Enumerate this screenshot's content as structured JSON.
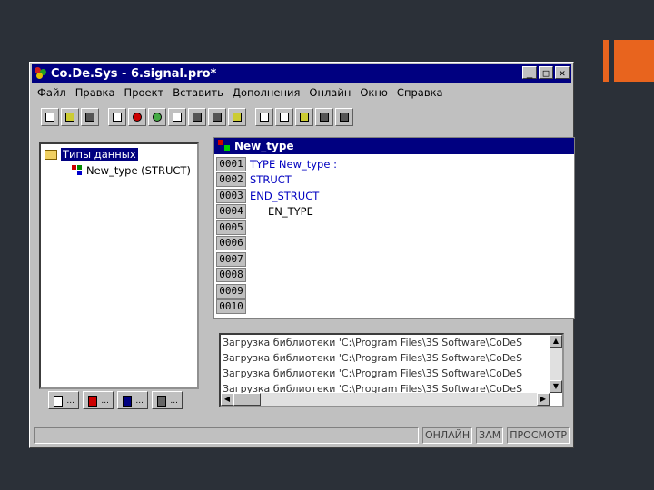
{
  "window": {
    "title": "Co.De.Sys - 6.signal.pro*",
    "controls": [
      "_",
      "□",
      "✕"
    ]
  },
  "menu": [
    "Файл",
    "Правка",
    "Проект",
    "Вставить",
    "Дополнения",
    "Онлайн",
    "Окно",
    "Справка"
  ],
  "tree": {
    "root": "Типы данных",
    "child": "New_type (STRUCT)"
  },
  "editor": {
    "title": "New_type",
    "lines": [
      {
        "num": "0001",
        "text": "TYPE New_type :"
      },
      {
        "num": "0002",
        "text": "STRUCT"
      },
      {
        "num": "0003",
        "text": "END_STRUCT"
      },
      {
        "num": "0004",
        "text": "EN_TYPE"
      },
      {
        "num": "0005",
        "text": ""
      },
      {
        "num": "0006",
        "text": ""
      },
      {
        "num": "0007",
        "text": ""
      },
      {
        "num": "0008",
        "text": ""
      },
      {
        "num": "0009",
        "text": ""
      },
      {
        "num": "0010",
        "text": ""
      }
    ]
  },
  "messages": [
    "Загрузка библиотеки 'C:\\Program Files\\3S Software\\CoDeS",
    "Загрузка библиотеки 'C:\\Program Files\\3S Software\\CoDeS",
    "Загрузка библиотеки 'C:\\Program Files\\3S Software\\CoDeS",
    "Загрузка библиотеки 'C:\\Program Files\\3S Software\\CoDeS"
  ],
  "status": [
    "ОНЛАЙН",
    "ЗАМ",
    "ПРОСМОТР"
  ]
}
